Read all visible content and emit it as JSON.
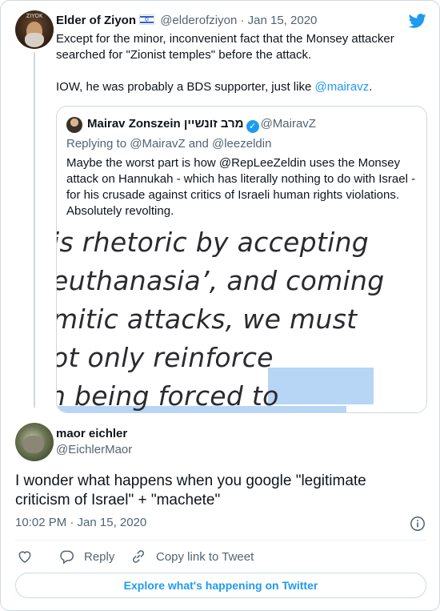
{
  "parent": {
    "name": "Elder of Ziyon",
    "avatar_label": "ZIYOK",
    "handle": "@elderofziyon",
    "separator": "·",
    "date": "Jan 15, 2020",
    "line1": "Except for the minor, inconvenient fact that the Monsey attacker searched for \"Zionist temples\" before the attack.",
    "line2_prefix": "IOW, he was probably a BDS supporter, just like ",
    "line2_link": "@mairavz",
    "line2_suffix": "."
  },
  "quote": {
    "name": "Mairav Zonszein מרב זונשיין",
    "handle": "@MairavZ",
    "replying_prefix": "Replying to ",
    "replying_user1": "@MairavZ",
    "replying_and": " and ",
    "replying_user2": "@leezeldin",
    "text": "Maybe the worst part is how @RepLeeZeldin uses the Monsey attack on Hannukah - which has literally nothing to do with Israel - for his crusade against critics of Israeli human rights violations. Absolutely revolting.",
    "image_lines": [
      "is rhetoric by accepting",
      "euthanasia’, and coming",
      "mitic attacks, we must",
      "ot only reinforce",
      "n being forced to"
    ]
  },
  "reply": {
    "name": "maor eichler",
    "handle": "@EichlerMaor",
    "text": "I wonder what happens when you google \"legitimate criticism of Israel\" + \"machete\"",
    "timestamp": "10:02 PM · Jan 15, 2020"
  },
  "actions": {
    "reply_label": "Reply",
    "copy_label": "Copy link to Tweet"
  },
  "explore_label": "Explore what's happening on Twitter",
  "colors": {
    "accent": "#1d9bf0",
    "highlight": "#b7d5f5",
    "muted_text": "#536471"
  },
  "icons": [
    "twitter-logo-icon",
    "verified-badge-icon",
    "israel-flag-icon",
    "heart-icon",
    "reply-icon",
    "link-icon",
    "info-icon"
  ]
}
